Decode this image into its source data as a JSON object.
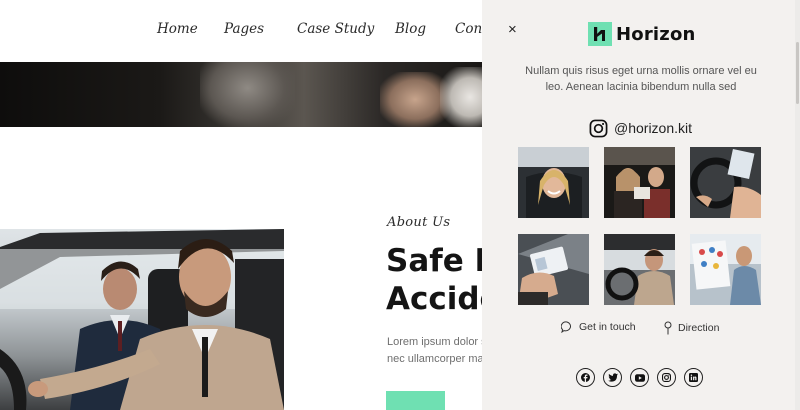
{
  "nav": {
    "items": [
      "Home",
      "Pages",
      "Case Study",
      "Blog",
      "Cont"
    ]
  },
  "about": {
    "label": "About Us",
    "title": "Safe D\nAccide",
    "body": "Lorem ipsum dolor s\nnec ullamcorper ma"
  },
  "panel": {
    "close_icon": "×",
    "logo_mark": "h",
    "logo_text": "Horizon",
    "description": "Nullam quis risus eget urna mollis ornare vel eu\nleo. Aenean lacinia bibendum nulla sed",
    "instagram": {
      "icon": "instagram-icon",
      "handle": "@horizon.kit"
    },
    "gallery_count": 6,
    "links": [
      {
        "icon": "chat-bubble-icon",
        "label": "Get in touch"
      },
      {
        "icon": "map-pin-icon",
        "label": "Direction"
      }
    ],
    "socials": [
      "facebook-icon",
      "twitter-icon",
      "youtube-icon",
      "instagram-icon",
      "linkedin-icon"
    ]
  },
  "colors": {
    "accent": "#6fe0b2",
    "panel_bg": "#f3f1ef",
    "text_dark": "#141414",
    "text_muted": "#6f6f6f"
  }
}
